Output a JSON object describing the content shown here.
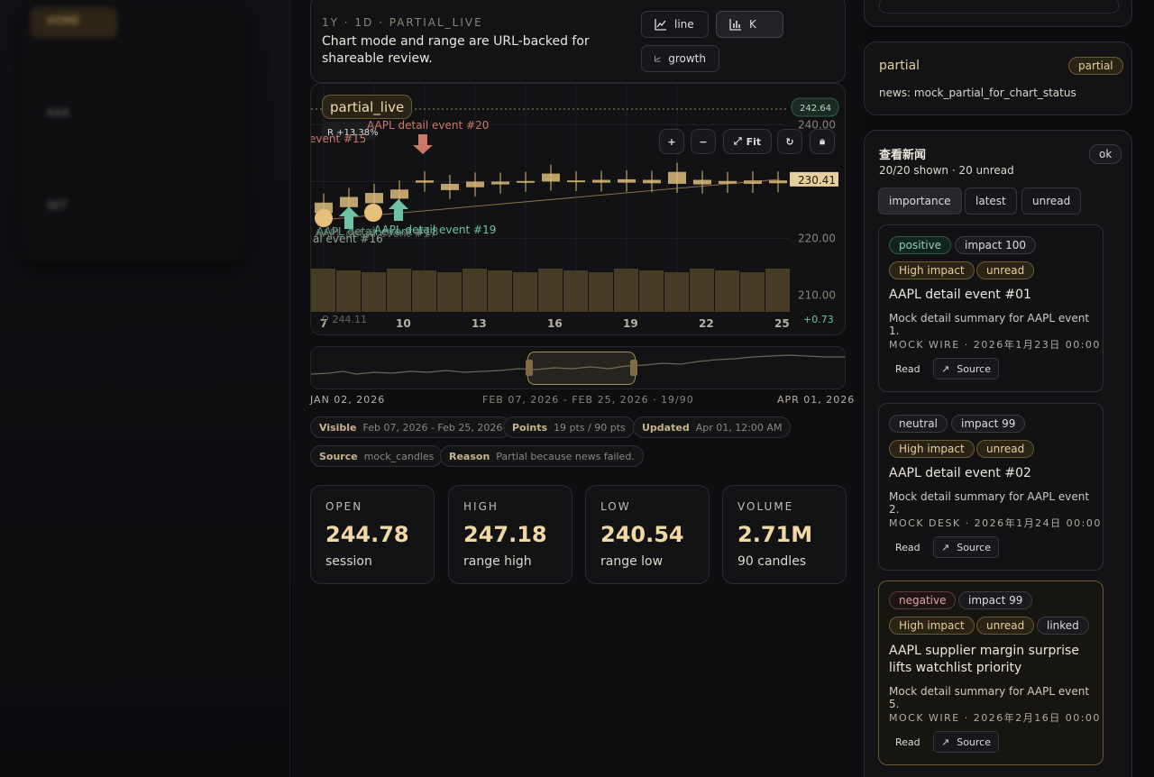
{
  "nav": {
    "items": [
      {
        "label": "HOME",
        "active": true
      },
      {
        "label": "AAA",
        "active": false
      },
      {
        "label": "SET",
        "active": false
      }
    ]
  },
  "chart_panel": {
    "eyebrow": "1Y · 1D · PARTIAL_LIVE",
    "hint": "Chart mode and range are URL-backed for shareable review.",
    "modes": {
      "line": "line",
      "k": "K",
      "growth": "growth"
    },
    "status": "partial_live",
    "ratio_label": "R +13.38%",
    "last_price": "230.41",
    "reference_price": "242.64",
    "low_tag": "244.11",
    "change_tag": "+0.73",
    "fit_label": "Fit"
  },
  "chart_data": {
    "type": "candlestick",
    "x_ticks": [
      "7",
      "10",
      "13",
      "16",
      "19",
      "22",
      "25"
    ],
    "y_ticks": [
      240,
      230,
      220,
      210
    ],
    "ylim": [
      206,
      244
    ],
    "candles": [
      {
        "o": 224.5,
        "c": 226.3
      },
      {
        "o": 225.5,
        "c": 227.3
      },
      {
        "o": 226.2,
        "c": 228.0
      },
      {
        "o": 227.0,
        "c": 228.6
      },
      {
        "o": 229.8,
        "c": 230.2
      },
      {
        "o": 228.5,
        "c": 229.6
      },
      {
        "o": 229.0,
        "c": 230.0
      },
      {
        "o": 229.5,
        "c": 230.0
      },
      {
        "o": 229.8,
        "c": 230.1
      },
      {
        "o": 230.0,
        "c": 231.4
      },
      {
        "o": 229.9,
        "c": 230.2
      },
      {
        "o": 229.8,
        "c": 230.3
      },
      {
        "o": 229.8,
        "c": 230.4
      },
      {
        "o": 229.7,
        "c": 230.3
      },
      {
        "o": 229.6,
        "c": 231.7
      },
      {
        "o": 229.5,
        "c": 230.3
      },
      {
        "o": 229.6,
        "c": 230.1
      },
      {
        "o": 229.6,
        "c": 230.2
      },
      {
        "o": 229.7,
        "c": 230.2
      }
    ],
    "events": [
      {
        "label": "AAPL detail event #20",
        "kind": "negative"
      },
      {
        "label": "event #15",
        "kind": "negative"
      },
      {
        "label": "AAPL detail event #19",
        "kind": "positive"
      },
      {
        "label": "AAPL detail event #18",
        "kind": "positive"
      },
      {
        "label": "AAPL detail event #17",
        "kind": "positive"
      },
      {
        "label": "al event #16",
        "kind": "positive"
      }
    ]
  },
  "navigator": {
    "start": "JAN 02, 2026",
    "window": "FEB 07, 2026 - FEB 25, 2026 · 19/90",
    "end": "APR 01, 2026"
  },
  "meta": {
    "visible": {
      "k": "Visible",
      "v": "Feb 07, 2026 - Feb 25, 2026"
    },
    "points": {
      "k": "Points",
      "v": "19 pts / 90 pts"
    },
    "updated": {
      "k": "Updated",
      "v": "Apr 01, 12:00 AM"
    },
    "source": {
      "k": "Source",
      "v": "mock_candles"
    },
    "reason": {
      "k": "Reason",
      "v": "Partial because news failed."
    }
  },
  "stats": [
    {
      "label": "OPEN",
      "value": "244.78",
      "sub": "session"
    },
    {
      "label": "HIGH",
      "value": "247.18",
      "sub": "range high"
    },
    {
      "label": "LOW",
      "value": "240.54",
      "sub": "range low"
    },
    {
      "label": "VOLUME",
      "value": "2.71M",
      "sub": "90 candles"
    }
  ],
  "status_card": {
    "title": "partial",
    "badge": "partial",
    "detail": "news: mock_partial_for_chart_status"
  },
  "news_panel": {
    "title": "查看新闻",
    "summary": "20/20 shown · 20 unread",
    "ok": "ok",
    "sorts": [
      "importance",
      "latest",
      "unread"
    ],
    "items": [
      {
        "sentiment": "positive",
        "impact": "impact 100",
        "level": "High impact",
        "state": "unread",
        "title": "AAPL detail event #01",
        "summary": "Mock detail summary for AAPL event 1.",
        "source": "MOCK WIRE · 2026年1月23日 00:00",
        "read": "Read",
        "source_btn": "Source"
      },
      {
        "sentiment": "neutral",
        "impact": "impact 99",
        "level": "High impact",
        "state": "unread",
        "title": "AAPL detail event #02",
        "summary": "Mock detail summary for AAPL event 2.",
        "source": "MOCK DESK · 2026年1月24日 00:00",
        "read": "Read",
        "source_btn": "Source"
      },
      {
        "sentiment": "negative",
        "impact": "impact 99",
        "level": "High impact",
        "state": "unread",
        "linked": "linked",
        "title": "AAPL supplier margin surprise lifts watchlist priority",
        "summary": "Mock detail summary for AAPL event 5.",
        "source": "MOCK WIRE · 2026年2月16日 00:00",
        "read": "Read",
        "source_btn": "Source"
      }
    ]
  }
}
